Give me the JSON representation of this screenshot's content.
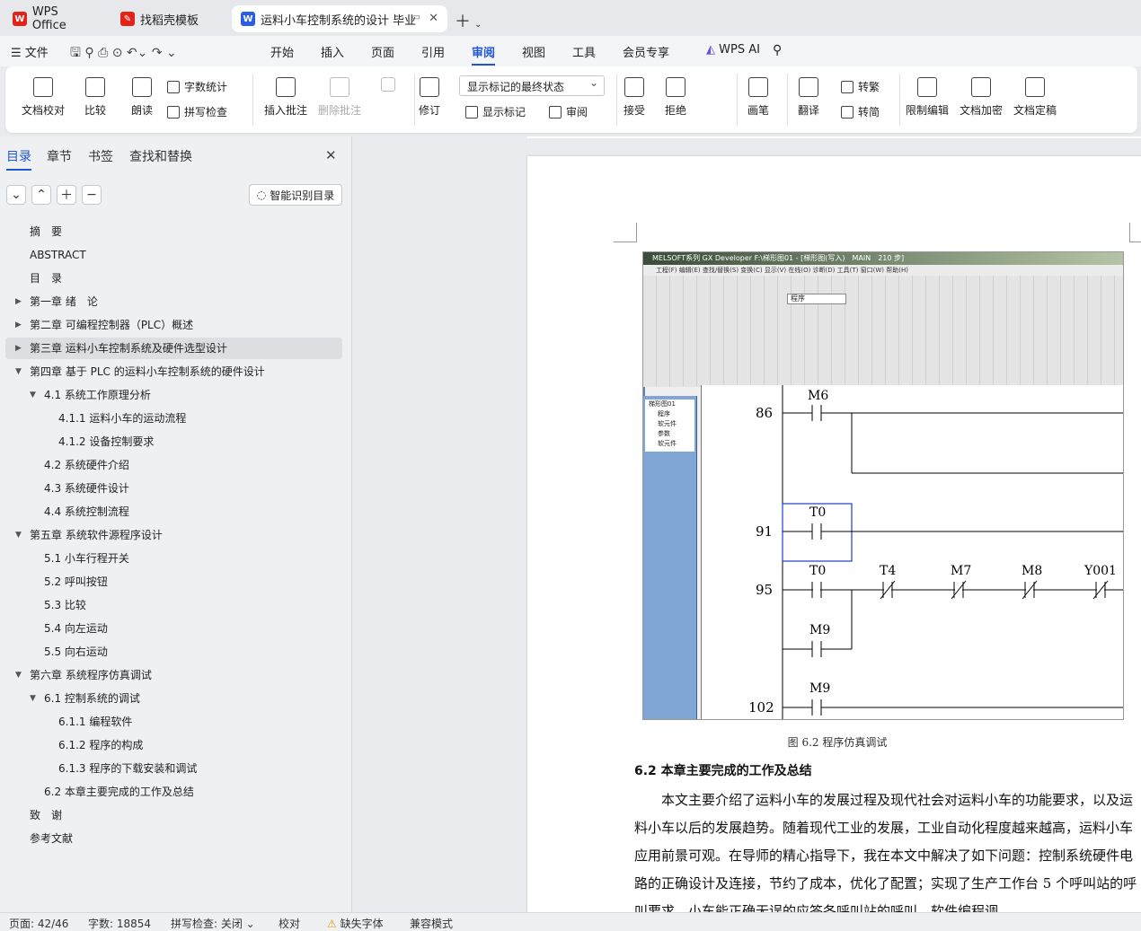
{
  "tabs": [
    {
      "label": "WPS Office"
    },
    {
      "label": "找稻壳模板"
    },
    {
      "label": "运料小车控制系统的设计 毕业"
    }
  ],
  "menu": {
    "file": "文件",
    "items": [
      "开始",
      "插入",
      "页面",
      "引用",
      "审阅",
      "视图",
      "工具",
      "会员专享"
    ],
    "active": "审阅",
    "ai": "WPS AI"
  },
  "ribbon": {
    "doc_check": "文档校对",
    "compare": "比较",
    "read": "朗读",
    "word_count": "字数统计",
    "spell": "拼写检查",
    "insert_comment": "插入批注",
    "delete_comment": "删除批注",
    "revise": "修订",
    "show_state": "显示标记的最终状态",
    "show_marks": "显示标记",
    "review": "审阅",
    "accept": "接受",
    "reject": "拒绝",
    "pen": "画笔",
    "translate": "翻译",
    "to_trad": "转繁",
    "to_simp": "转简",
    "restrict": "限制编辑",
    "encrypt": "文档加密",
    "finalize": "文档定稿"
  },
  "sidebar": {
    "tabs": [
      "目录",
      "章节",
      "书签",
      "查找和替换"
    ],
    "smart_btn": "智能识别目录",
    "toc": [
      {
        "label": "摘　要",
        "level": 0,
        "arrow": ""
      },
      {
        "label": "ABSTRACT",
        "level": 0,
        "arrow": ""
      },
      {
        "label": "目　录",
        "level": 0,
        "arrow": ""
      },
      {
        "label": "第一章 绪　论",
        "level": 0,
        "arrow": "▶"
      },
      {
        "label": "第二章 可编程控制器（PLC）概述",
        "level": 0,
        "arrow": "▶"
      },
      {
        "label": "第三章 运料小车控制系统及硬件选型设计",
        "level": 0,
        "arrow": "▶",
        "selected": true
      },
      {
        "label": "第四章 基于 PLC 的运料小车控制系统的硬件设计",
        "level": 0,
        "arrow": "▼"
      },
      {
        "label": "4.1 系统工作原理分析",
        "level": 1,
        "arrow": "▼"
      },
      {
        "label": "4.1.1 运料小车的运动流程",
        "level": 2,
        "arrow": ""
      },
      {
        "label": "4.1.2 设备控制要求",
        "level": 2,
        "arrow": ""
      },
      {
        "label": "4.2 系统硬件介绍",
        "level": 1,
        "arrow": ""
      },
      {
        "label": "4.3 系统硬件设计",
        "level": 1,
        "arrow": ""
      },
      {
        "label": "4.4 系统控制流程",
        "level": 1,
        "arrow": ""
      },
      {
        "label": "第五章 系统软件源程序设计",
        "level": 0,
        "arrow": "▼"
      },
      {
        "label": "5.1 小车行程开关",
        "level": 1,
        "arrow": ""
      },
      {
        "label": "5.2 呼叫按钮",
        "level": 1,
        "arrow": ""
      },
      {
        "label": "5.3 比较",
        "level": 1,
        "arrow": ""
      },
      {
        "label": "5.4 向左运动",
        "level": 1,
        "arrow": ""
      },
      {
        "label": "5.5 向右运动",
        "level": 1,
        "arrow": ""
      },
      {
        "label": "第六章 系统程序仿真调试",
        "level": 0,
        "arrow": "▼"
      },
      {
        "label": "6.1 控制系统的调试",
        "level": 1,
        "arrow": "▼"
      },
      {
        "label": "6.1.1 编程软件",
        "level": 2,
        "arrow": ""
      },
      {
        "label": "6.1.2 程序的构成",
        "level": 2,
        "arrow": ""
      },
      {
        "label": "6.1.3 程序的下载安装和调试",
        "level": 2,
        "arrow": ""
      },
      {
        "label": "6.2 本章主要完成的工作及总结",
        "level": 1,
        "arrow": ""
      },
      {
        "label": "致　谢",
        "level": 0,
        "arrow": ""
      },
      {
        "label": "参考文献",
        "level": 0,
        "arrow": ""
      }
    ]
  },
  "document": {
    "screenshot": {
      "title": "MELSOFT系列 GX Developer F:\\梯形图01 - [梯形图(写入)　MAIN　210 步]",
      "menu": "工程(F) 编辑(E) 查找/替换(S) 变换(C) 显示(V) 在线(O) 诊断(D) 工具(T) 窗口(W) 帮助(H)",
      "combo": "程序",
      "tree": [
        "梯形图01",
        "程序",
        "软元件",
        "参数",
        "软元件"
      ],
      "rungs": [
        "86",
        "91",
        "95",
        "102"
      ],
      "contacts": [
        "M6",
        "T0",
        "T0",
        "T4",
        "M7",
        "M8",
        "Y001",
        "M9",
        "M9"
      ]
    },
    "caption": "图 6.2 程序仿真调试",
    "heading": "6.2 本章主要完成的工作及总结",
    "paragraph": "本文主要介绍了运料小车的发展过程及现代社会对运料小车的功能要求，以及运料小车以后的发展趋势。随着现代工业的发展，工业自动化程度越来越高，运料小车应用前景可观。在导师的精心指导下，我在本文中解决了如下问题：控制系统硬件电路的正确设计及连接，节约了成本，优化了配置；实现了生产工作台 5 个呼叫站的呼叫要求，小车能正确无误的应答各呼叫站的呼叫，软件编程调"
  },
  "status": {
    "page": "页面: 42/46",
    "words": "字数: 18854",
    "spell": "拼写检查: 关闭",
    "proof": "校对",
    "missing_font": "缺失字体",
    "compat": "兼容模式"
  },
  "colors": {
    "accent": "#1f55d6",
    "wps_red": "#e2231a",
    "doc_blue": "#2b5ce6"
  }
}
